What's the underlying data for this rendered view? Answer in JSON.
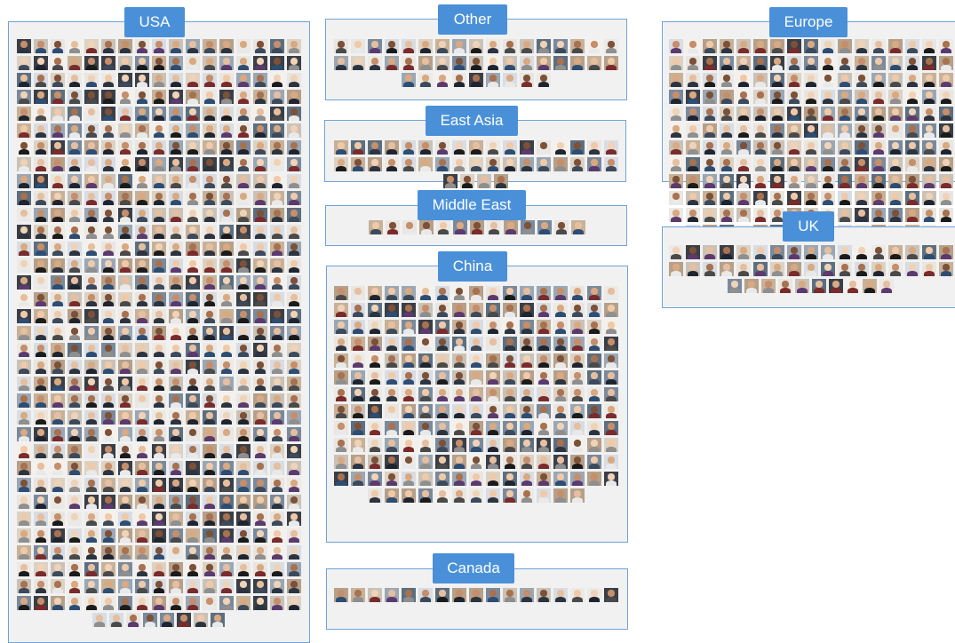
{
  "groups": [
    {
      "id": "usa",
      "label": "USA",
      "count": 586
    },
    {
      "id": "other",
      "label": "Other",
      "count": 43
    },
    {
      "id": "east_asia",
      "label": "East Asia",
      "count": 38
    },
    {
      "id": "middle_east",
      "label": "Middle East",
      "count": 13
    },
    {
      "id": "china",
      "label": "China",
      "count": 217
    },
    {
      "id": "canada",
      "label": "Canada",
      "count": 17
    },
    {
      "id": "europe",
      "label": "Europe",
      "count": 202
    },
    {
      "id": "uk",
      "label": "UK",
      "count": 44
    }
  ],
  "colors": {
    "panel_border": "#6fa3d8",
    "panel_fill": "#f1f1f1",
    "label_fill": "#4a90d9",
    "label_text": "#ffffff"
  },
  "thumbnail_icon": "person-portrait-icon"
}
